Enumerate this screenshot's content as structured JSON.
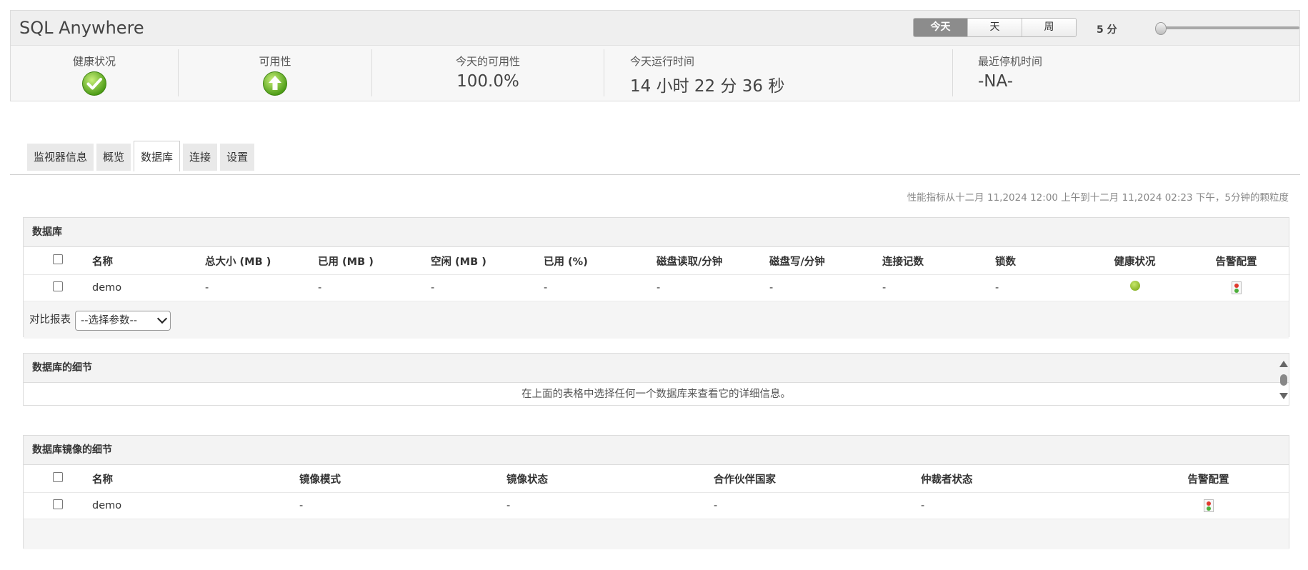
{
  "app": {
    "title": "SQL Anywhere"
  },
  "period": {
    "options": [
      "今天",
      "天",
      "周"
    ],
    "selected": "今天"
  },
  "interval": {
    "label": "5 分",
    "slider_fraction": 0.0
  },
  "stats": {
    "health_label": "健康状况",
    "availability_label": "可用性",
    "today_availability_label": "今天的可用性",
    "today_availability_value": "100.0%",
    "uptime_label": "今天运行时间",
    "uptime_value": "14 小时 22 分 36 秒",
    "last_downtime_label": "最近停机时间",
    "last_downtime_value": "-NA-"
  },
  "tabs": [
    {
      "label": "监视器信息"
    },
    {
      "label": "概览"
    },
    {
      "label": "数据库",
      "active": true
    },
    {
      "label": "连接"
    },
    {
      "label": "设置"
    }
  ],
  "perf_note": "性能指标从十二月 11,2024 12:00 上午到十二月 11,2024 02:23 下午，5分钟的颗粒度",
  "databases": {
    "title": "数据库",
    "columns": [
      "名称",
      "总大小 (MB )",
      "已用 (MB )",
      "空闲 (MB )",
      "已用 (%)",
      "磁盘读取/分钟",
      "磁盘写/分钟",
      "连接记数",
      "锁数",
      "健康状况",
      "告警配置"
    ],
    "rows": [
      {
        "name": "demo",
        "total": "-",
        "used": "-",
        "free": "-",
        "used_pct": "-",
        "disk_read": "-",
        "disk_write": "-",
        "connections": "-",
        "locks": "-",
        "health": "green"
      }
    ],
    "compare_label": "对比报表",
    "compare_select": "--选择参数--"
  },
  "database_details": {
    "title": "数据库的细节",
    "message": "在上面的表格中选择任何一个数据库来查看它的详细信息。"
  },
  "mirroring": {
    "title": "数据库镜像的细节",
    "columns": [
      "名称",
      "镜像模式",
      "镜像状态",
      "合作伙伴国家",
      "仲裁者状态",
      "告警配置"
    ],
    "rows": [
      {
        "name": "demo",
        "mode": "-",
        "state": "-",
        "partner": "-",
        "witness": "-"
      }
    ]
  }
}
